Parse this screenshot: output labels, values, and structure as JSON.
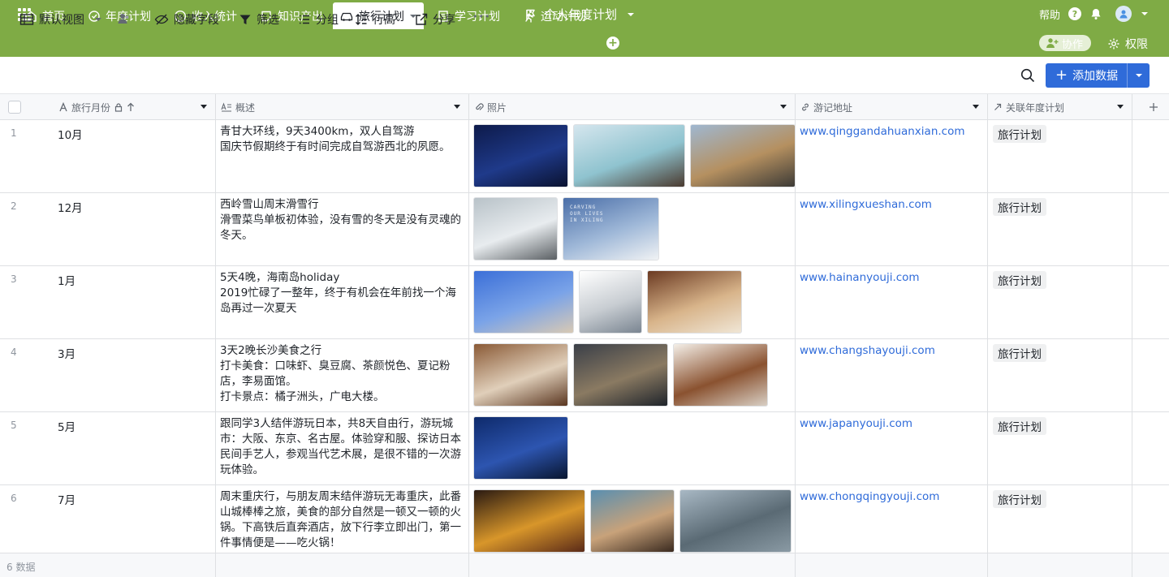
{
  "app": {
    "title": "个人年度计划",
    "help_label": "帮助",
    "help_glyph": "?"
  },
  "tabs": [
    {
      "label": "首页",
      "icon": "home-icon"
    },
    {
      "label": "年度计划",
      "icon": "target-icon"
    },
    {
      "label": "收入统计",
      "icon": "dollar-icon"
    },
    {
      "label": "知识产出",
      "icon": "note-icon"
    },
    {
      "label": "旅行计划",
      "icon": "car-icon",
      "active": true
    },
    {
      "label": "学习计划",
      "icon": "doc-icon"
    },
    {
      "label": "运动计划",
      "icon": "run-icon"
    }
  ],
  "actions": {
    "add_tab_glyph": "+",
    "collab_label": "协作",
    "permission_label": "权限"
  },
  "toolbar": {
    "view_label": "默认视图",
    "hide_fields_label": "隐藏字段",
    "filter_label": "筛选",
    "group_label": "分组",
    "row_height_label": "行高",
    "share_label": "分享",
    "more_glyph": "•••",
    "add_data_label": "添加数据",
    "add_data_glyph": "+"
  },
  "columns": {
    "month": "旅行月份",
    "desc": "概述",
    "photo": "照片",
    "addr": "游记地址",
    "plan": "关联年度计划"
  },
  "rows": [
    {
      "num": "1",
      "month": "10月",
      "desc": [
        "青甘大环线，9天3400km，双人自驾游",
        "国庆节假期终于有时间完成自驾游西北的夙愿。"
      ],
      "addr": "www.qinggandahuanxian.com",
      "plan": "旅行计划",
      "photos": [
        {
          "w": 117,
          "colors": [
            "#0d1a4a",
            "#1f3a8a",
            "#0a1230"
          ]
        },
        {
          "w": 138,
          "colors": [
            "#d5e6ee",
            "#8fc3cf",
            "#4a3a2f"
          ]
        },
        {
          "w": 130,
          "colors": [
            "#9fb7d0",
            "#b59060",
            "#3c3a36"
          ]
        }
      ]
    },
    {
      "num": "2",
      "month": "12月",
      "desc": [
        "西岭雪山周末滑雪行",
        "滑雪菜鸟单板初体验，没有雪的冬天是没有灵魂的冬天。"
      ],
      "addr": "www.xilingxueshan.com",
      "plan": "旅行计划",
      "photos": [
        {
          "w": 104,
          "colors": [
            "#b8c2c8",
            "#e8ecef",
            "#5a5f63"
          ]
        },
        {
          "w": 119,
          "colors": [
            "#4a6ea8",
            "#9fb8d8",
            "#f0f2f4"
          ],
          "caption": "CARVING\nOUR LIVES\nIN XILING"
        }
      ]
    },
    {
      "num": "3",
      "month": "1月",
      "desc": [
        "5天4晚，海南岛holiday",
        "2019忙碌了一整年，终于有机会在年前找一个海岛再过一次夏天"
      ],
      "addr": "www.hainanyouji.com",
      "plan": "旅行计划",
      "photos": [
        {
          "w": 124,
          "colors": [
            "#3b6fd8",
            "#7aa3e8",
            "#d8c9b4"
          ]
        },
        {
          "w": 78,
          "colors": [
            "#ffffff",
            "#c8cdd2",
            "#7a8591"
          ]
        },
        {
          "w": 117,
          "colors": [
            "#6b3a22",
            "#d8b48a",
            "#f0e6d6"
          ]
        }
      ]
    },
    {
      "num": "4",
      "month": "3月",
      "desc": [
        "3天2晚长沙美食之行",
        "打卡美食：口味虾、臭豆腐、茶颜悦色、夏记粉店，李易面馆。",
        "打卡景点：橘子洲头，广电大楼。"
      ],
      "addr": "www.changshayouji.com",
      "plan": "旅行计划",
      "photos": [
        {
          "w": 117,
          "colors": [
            "#8a5a36",
            "#e0cfba",
            "#5a3620"
          ]
        },
        {
          "w": 117,
          "colors": [
            "#3a3f48",
            "#8a7a62",
            "#1f242b"
          ]
        },
        {
          "w": 117,
          "colors": [
            "#f4efe8",
            "#8a5230",
            "#d8cfc4"
          ]
        }
      ]
    },
    {
      "num": "5",
      "month": "5月",
      "desc": [
        "跟同学3人结伴游玩日本，共8天自由行，游玩城市：大阪、东京、名古屋。体验穿和服、探访日本民间手艺人，参观当代艺术展，是很不错的一次游玩体验。"
      ],
      "addr": "www.japanyouji.com",
      "plan": "旅行计划",
      "photos": [
        {
          "w": 117,
          "colors": [
            "#0e2a6b",
            "#2d55b0",
            "#08152f"
          ]
        }
      ]
    },
    {
      "num": "6",
      "month": "7月",
      "desc": [
        "周末重庆行，与朋友周末结伴游玩无毒重庆，此番山城棒棒之旅，美食的部分自然是一顿又一顿的火锅。下高铁后直奔酒店，放下行李立即出门，第一件事情便是——吃火锅！"
      ],
      "addr": "www.chongqingyouji.com",
      "plan": "旅行计划",
      "photos": [
        {
          "w": 138,
          "colors": [
            "#2a1a12",
            "#d8962a",
            "#5a2a18"
          ]
        },
        {
          "w": 104,
          "colors": [
            "#5a8fb0",
            "#c8a27a",
            "#3a2a1f"
          ]
        },
        {
          "w": 138,
          "colors": [
            "#a8b8c4",
            "#5a6a74",
            "#8a9aa4"
          ]
        }
      ]
    }
  ],
  "footer": {
    "count_label": "6 数据"
  }
}
